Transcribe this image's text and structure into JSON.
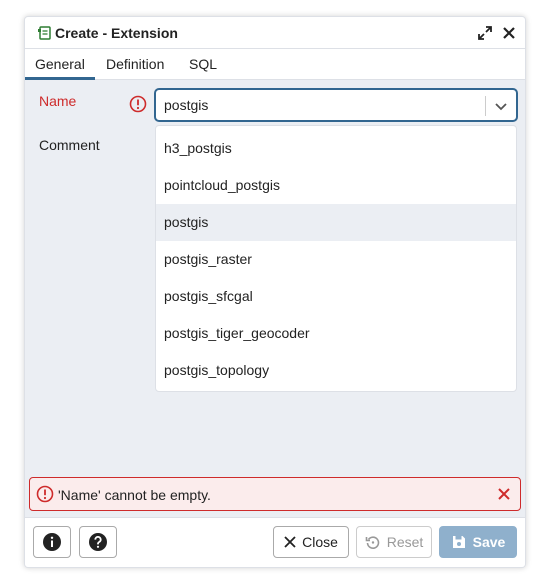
{
  "window": {
    "title": "Create - Extension"
  },
  "tabs": [
    {
      "label": "General"
    },
    {
      "label": "Definition"
    },
    {
      "label": "SQL"
    }
  ],
  "form": {
    "name_label": "Name",
    "name_value": "postgis",
    "comment_label": "Comment"
  },
  "dropdown": {
    "options": [
      {
        "label": "h3_postgis"
      },
      {
        "label": "pointcloud_postgis"
      },
      {
        "label": "postgis"
      },
      {
        "label": "postgis_raster"
      },
      {
        "label": "postgis_sfcgal"
      },
      {
        "label": "postgis_tiger_geocoder"
      },
      {
        "label": "postgis_topology"
      }
    ]
  },
  "error": {
    "message": "'Name' cannot be empty."
  },
  "footer": {
    "close_label": "Close",
    "reset_label": "Reset",
    "save_label": "Save"
  },
  "colors": {
    "accent": "#326690",
    "error": "#ce2b2b",
    "save_disabled": "#8fb0cc"
  }
}
